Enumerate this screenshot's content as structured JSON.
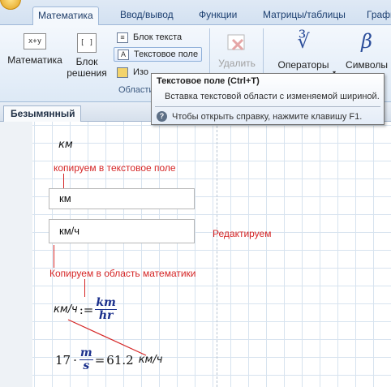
{
  "ribbon_tabs": [
    "Математика",
    "Ввод/вывод",
    "Функции",
    "Матрицы/таблицы",
    "Графи"
  ],
  "ribbon": {
    "math_button": "Математика",
    "math_icon_text": "x+y",
    "block_button": "Блок решения",
    "block_icon_text": "[ ]",
    "small_items": [
      "Блок текста",
      "Текстовое поле",
      "Изо"
    ],
    "group_label": "Области",
    "delete_button": "Удалить",
    "operators_button": "Операторы",
    "symbols_button": "Символы",
    "beta_glyph": "β"
  },
  "document_tab": "Безымянный",
  "tooltip": {
    "title": "Текстовое поле (Ctrl+T)",
    "description": "Вставка текстовой области с изменяемой шириной.",
    "help": "Чтобы открыть справку, нажмите клавишу F1."
  },
  "worksheet": {
    "unit_top": "км",
    "note_copy_text": "копируем в текстовое поле",
    "textbox1": "км",
    "textbox2": "км/ч",
    "note_edit": "Редактируем",
    "note_copy_math": "Копируем в область математики",
    "def_lhs": "км/ч",
    "def_assign": ":=",
    "frac_num": "km",
    "frac_den": "hr",
    "calc_factor": "17",
    "calc_dot": "·",
    "calc_frac_num": "m",
    "calc_frac_den": "s",
    "calc_eq": "=",
    "calc_result": "61.2",
    "calc_unit": "км/ч"
  },
  "colors": {
    "accent_red": "#d52626",
    "math_blue": "#1a2f8c"
  }
}
